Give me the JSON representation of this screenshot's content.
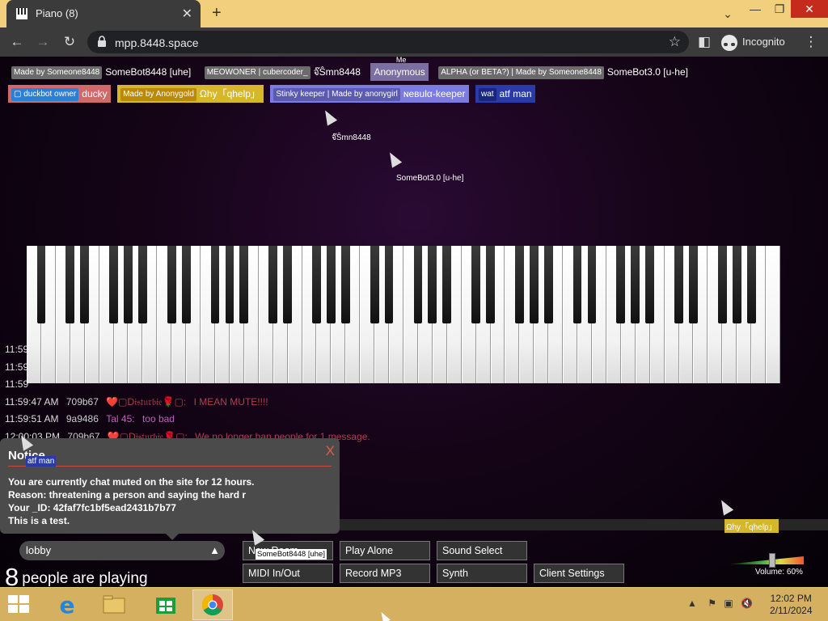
{
  "browser": {
    "tab_title": "Piano (8)",
    "tab_close": "✕",
    "new_tab": "+",
    "url": "mpp.8448.space",
    "incognito_label": "Incognito"
  },
  "userlist": {
    "row1": [
      {
        "tag": "Made by Someone8448",
        "tag_color": "#6b6b6b",
        "name": "SomeBot8448 [uhe]",
        "bg": "transparent"
      },
      {
        "tag": "MEOWONER | cubercoder_",
        "tag_color": "#6b6b6b",
        "name": "จ๊Ŝmn8448",
        "bg": "transparent"
      },
      {
        "tag": "",
        "tag_color": "",
        "name": "Anonymous",
        "bg": "#7a6fa0",
        "me_label": "Me"
      },
      {
        "tag": "ALPHA (or BETA?) | Made by Someone8448",
        "tag_color": "#6b6b6b",
        "name": "SomeBot3.0 [u-he]",
        "bg": "transparent"
      }
    ],
    "row2": [
      {
        "tag": "▢ duckbot owner",
        "tag_color": "#2d7fd6",
        "name": "ducky",
        "bg": "#cf6a6a"
      },
      {
        "tag": "Made by Anonygold",
        "tag_color": "#d4a010",
        "name": "Ωhy「qhelp」",
        "bg": "#d6b72a"
      },
      {
        "tag": "Stinky keeper | Made by anonygirl",
        "tag_color": "#6a6ac8",
        "name": "ɴeвulα-keeper",
        "bg": "#7c7ce0"
      },
      {
        "tag": "wat",
        "tag_color": "#2030a0",
        "name": "atf man",
        "bg": "#2a3aa8"
      }
    ]
  },
  "cursors": {
    "c1": "จ๊Ŝmn8448",
    "c2": "SomeBot3.0 [u-he]",
    "c3": "atf man",
    "c4": "SomeBot8448 [uhe]",
    "c5": "Ωhy「qhelp」"
  },
  "chat": [
    {
      "ts": "11:59",
      "uid": "",
      "nick": "",
      "nick_color": "#ccc",
      "msg": ""
    },
    {
      "ts": "11:59",
      "uid": "",
      "nick": "",
      "nick_color": "#ccc",
      "msg": ""
    },
    {
      "ts": "11:59",
      "uid": "",
      "nick": "",
      "nick_color": "#ccc",
      "msg": ""
    },
    {
      "ts": "11:59:47 AM",
      "uid": "709b67",
      "nick": "❤️▢D𝔦𝔰𝔱𝔲𝔯𝔟𝔦𝔢🌹▢:",
      "nick_color": "#b04050",
      "msg": "I MEAN MUTE!!!!",
      "msg_color": "#b04050"
    },
    {
      "ts": "11:59:51 AM",
      "uid": "9a9486",
      "nick": "Tal 45:",
      "nick_color": "#c060c0",
      "msg": "too bad",
      "msg_color": "#c060c0"
    },
    {
      "ts": "12:00:03 PM",
      "uid": "709b67",
      "nick": "❤️▢D𝔦𝔰𝔱𝔲𝔯𝔟𝔦𝔢🌹▢:",
      "nick_color": "#b04050",
      "msg": "We no longer ban people for 1 message.",
      "msg_color": "#b04050"
    }
  ],
  "notice": {
    "title": "Notice",
    "close": "X",
    "line1": "You are currently chat muted on the site for 12 hours.",
    "line2": "Reason: threatening a person and saying the hard r",
    "line3": "Your _ID: 42faf7fc1bf5ead2431b7b77",
    "line4": "This is a test."
  },
  "controls": {
    "room": "lobby",
    "room_arrow": "▲",
    "people_count": "8",
    "people_label": "people are playing",
    "new_room": "New Room",
    "play_alone": "Play Alone",
    "sound_select": "Sound Select",
    "midi": "MIDI In/Out",
    "record": "Record MP3",
    "synth": "Synth",
    "client_settings": "Client Settings",
    "volume_label": "Volume: 60%",
    "volume": 0.6
  },
  "taskbar": {
    "time": "12:02 PM",
    "date": "2/11/2024"
  }
}
